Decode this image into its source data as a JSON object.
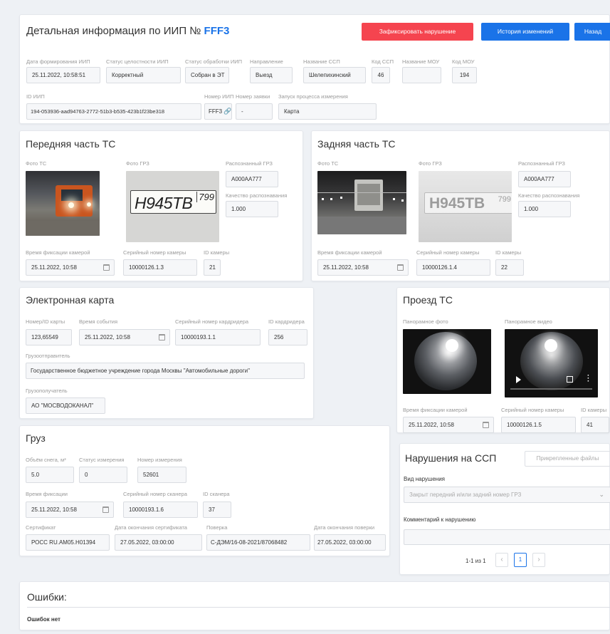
{
  "header": {
    "title_prefix": "Детальная информация по ИИП №",
    "iip_number": "FFF3",
    "btn_violation": "Зафиксировать нарушение",
    "btn_history": "История изменений",
    "btn_back": "Назад",
    "colors": {
      "accent": "#1a73e8",
      "danger": "#f5444f",
      "primary": "#1a73e8"
    }
  },
  "info": {
    "formed_label": "Дата формирования ИИП",
    "formed_value": "25.11.2022, 10:58:51",
    "integrity_label": "Статус целостности ИИП",
    "integrity_value": "Корректный",
    "processing_label": "Статус обработки ИИП",
    "processing_value": "Собран в ЭТ",
    "direction_label": "Направление",
    "direction_value": "Выезд",
    "ssp_name_label": "Название ССП",
    "ssp_name_value": "Шелепихинский",
    "ssp_code_label": "Код ССП",
    "ssp_code_value": "46",
    "mou_name_label": "Название МОУ",
    "mou_name_value": "",
    "mou_code_label": "Код МОУ",
    "mou_code_value": "194",
    "id_label": "ID ИИП",
    "id_value": "194-053936-aad94763-2772-51b3-b535-423b1f23be318",
    "number_label": "Номер ИИП",
    "number_value": "FFF3",
    "request_label": "Номер заявки",
    "request_value": "-",
    "launch_label": "Запуск процесса измерения",
    "launch_value": "Карта"
  },
  "front": {
    "title": "Передняя часть ТС",
    "photo_label": "Фото ТС",
    "grz_photo_label": "Фото ГРЗ",
    "plate_text": "Н945ТВ",
    "plate_region": "799",
    "recognized_label": "Распознанный ГРЗ",
    "recognized_value": "А000АА777",
    "quality_label": "Качество распознавания",
    "quality_value": "1.000",
    "time_label": "Время фиксации камерой",
    "time_value": "25.11.2022, 10:58",
    "serial_label": "Серийный номер камеры",
    "serial_value": "10000126.1.3",
    "camid_label": "ID камеры",
    "camid_value": "21"
  },
  "rear": {
    "title": "Задняя часть ТС",
    "photo_label": "Фото ТС",
    "grz_photo_label": "Фото ГРЗ",
    "plate_text": "Н945ТВ",
    "plate_region": "799",
    "recognized_label": "Распознанный ГРЗ",
    "recognized_value": "А000АА777",
    "quality_label": "Качество распознавания",
    "quality_value": "1.000",
    "time_label": "Время фиксации камерой",
    "time_value": "25.11.2022, 10:58",
    "serial_label": "Серийный номер камеры",
    "serial_value": "10000126.1.4",
    "camid_label": "ID камеры",
    "camid_value": "22"
  },
  "ecard": {
    "title": "Электронная карта",
    "card_label": "Номер/ID карты",
    "card_value": "123,65549",
    "event_label": "Время события",
    "event_value": "25.11.2022, 10:58",
    "reader_serial_label": "Серийный номер кардридера",
    "reader_serial_value": "10000193.1.1",
    "reader_id_label": "ID кардридера",
    "reader_id_value": "256",
    "sender_label": "Грузоотправитель",
    "sender_value": "Государственное бюджетное учреждение города Москвы \"Автомобильные дороги\"",
    "receiver_label": "Грузополучатель",
    "receiver_value": "АО \"МОСВОДОКАНАЛ\""
  },
  "passage": {
    "title": "Проезд ТС",
    "pano_photo_label": "Панорамное фото",
    "pano_video_label": "Панорамное видео",
    "time_label": "Время фиксации камерой",
    "time_value": "25.11.2022, 10:58",
    "serial_label": "Серийный номер камеры",
    "serial_value": "10000126.1.5",
    "camid_label": "ID камеры",
    "camid_value": "41"
  },
  "cargo": {
    "title": "Груз",
    "volume_label": "Объём снега, м³",
    "volume_value": "5.0",
    "status_label": "Статус измерения",
    "status_value": "0",
    "meas_label": "Номер измерения",
    "meas_value": "52601",
    "time_label": "Время фиксации",
    "time_value": "25.11.2022, 10:58",
    "scanner_serial_label": "Серийный номер сканера",
    "scanner_serial_value": "10000193.1.6",
    "scanner_id_label": "ID сканера",
    "scanner_id_value": "37",
    "cert_label": "Сертификат",
    "cert_value": "РОСС RU.АМ05.Н01394",
    "cert_end_label": "Дата окончания сертификата",
    "cert_end_value": "27.05.2022, 03:00:00",
    "check_label": "Поверка",
    "check_value": "С-ДЭМ/16-08-2021/87068482",
    "check_end_label": "Дата окончания поверки",
    "check_end_value": "27.05.2022, 03:00:00"
  },
  "violations": {
    "title": "Нарушения на ССП",
    "attached_btn": "Прикрепленные файлы",
    "type_label": "Вид нарушения",
    "type_placeholder": "Закрыт передний и/или задний номер ГРЗ",
    "comment_label": "Комментарий к нарушению",
    "pager_text": "1-1 из 1",
    "page_current": "1"
  },
  "errors": {
    "title": "Ошибки:",
    "text": "Ошибок нет"
  }
}
